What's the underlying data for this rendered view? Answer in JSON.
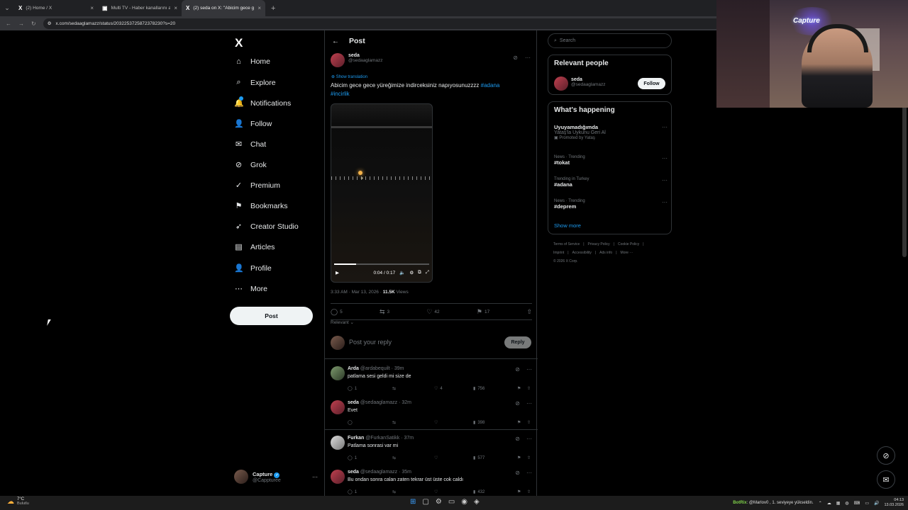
{
  "browser": {
    "tabs": [
      {
        "favicon": "X",
        "title": "(2) Home / X",
        "close": "×"
      },
      {
        "favicon": "▣",
        "title": "Multi TV - Haber kanallarını aynı",
        "close": "×"
      },
      {
        "favicon": "X",
        "title": "(2) seda on X: \"Abicim gece ge",
        "close": "×"
      }
    ],
    "new_tab": "+",
    "url": "x.com/sedaaglamazz/status/2032253725872378230?s=20"
  },
  "nav": {
    "logo": "X",
    "items": [
      {
        "icon": "home-icon",
        "glyph": "⌂",
        "label": "Home"
      },
      {
        "icon": "search-icon",
        "glyph": "⌕",
        "label": "Explore"
      },
      {
        "icon": "bell-icon",
        "glyph": "🔔",
        "label": "Notifications"
      },
      {
        "icon": "follow-icon",
        "glyph": "👤",
        "label": "Follow"
      },
      {
        "icon": "mail-icon",
        "glyph": "✉",
        "label": "Chat"
      },
      {
        "icon": "grok-icon",
        "glyph": "⊘",
        "label": "Grok"
      },
      {
        "icon": "premium-icon",
        "glyph": "✓",
        "label": "Premium"
      },
      {
        "icon": "bookmark-icon",
        "glyph": "⚑",
        "label": "Bookmarks"
      },
      {
        "icon": "rocket-icon",
        "glyph": "➶",
        "label": "Creator Studio"
      },
      {
        "icon": "articles-icon",
        "glyph": "▤",
        "label": "Articles"
      },
      {
        "icon": "profile-icon",
        "glyph": "👤",
        "label": "Profile"
      },
      {
        "icon": "more-icon",
        "glyph": "⋯",
        "label": "More"
      }
    ],
    "post_button": "Post",
    "account": {
      "name": "Capture",
      "handle": "@Cappturee",
      "menu": "···"
    }
  },
  "post": {
    "header": "Post",
    "author": {
      "name": "seda",
      "handle": "@sedaaglamazz"
    },
    "translate": "Show translation",
    "text": "Abicim gece gece yüreğimize indirceksiniz napıyosunuzzzz ",
    "tag1": "#adana",
    "tag2": "#incirlik",
    "video": {
      "time": "0:04 / 0:17",
      "progress": 0.23
    },
    "timestamp": "3:33 AM · Mar 13, 2026 · ",
    "views_count": "11.5K",
    "views_label": " Views",
    "stats": {
      "replies": "5",
      "reposts": "3",
      "likes": "42",
      "bookmarks": "17"
    },
    "sort": "Relevant ⌄",
    "reply_placeholder": "Post your reply",
    "reply_button": "Reply"
  },
  "replies": [
    {
      "name": "Arda",
      "handle": "@ardabequilt · 39m",
      "text": "patlama sesi geldi mi size de",
      "replies": "1",
      "reposts": "",
      "likes": "4",
      "views": "756"
    },
    {
      "name": "seda",
      "handle": "@sedaaglamazz · 32m",
      "text": "Evet",
      "replies": "",
      "reposts": "",
      "likes": "",
      "views": "398"
    },
    {
      "name": "Furkan",
      "handle": "@FurkanSatikk · 37m",
      "text": "Patlama sonrasi var mi",
      "replies": "1",
      "reposts": "",
      "likes": "",
      "views": "577"
    },
    {
      "name": "seda",
      "handle": "@sedaaglamazz · 35m",
      "text": "Bu ondan sonra calan zaten tekrar üst üste cok caldı",
      "replies": "1",
      "reposts": "",
      "likes": "",
      "views": "432"
    }
  ],
  "sidebar": {
    "search_placeholder": "Search",
    "relevant_title": "Relevant people",
    "person": {
      "name": "seda",
      "handle": "@sedaaglamazz",
      "button": "Follow"
    },
    "happening_title": "What's happening",
    "trends": [
      {
        "context": "",
        "title": "Uyuyamadığımda",
        "sub": "Yataş'la Uykunu Geri Al",
        "promo": "Promoted by Yataş"
      },
      {
        "context": "News · Trending",
        "title": "#tokat",
        "sub": "",
        "promo": ""
      },
      {
        "context": "Trending in Turkey",
        "title": "#adana",
        "sub": "",
        "promo": ""
      },
      {
        "context": "News · Trending",
        "title": "#deprem",
        "sub": "",
        "promo": ""
      }
    ],
    "show_more": "Show more",
    "footer": [
      "Terms of Service",
      "|",
      "Privacy Policy",
      "|",
      "Cookie Policy",
      "|",
      "Imprint",
      "|",
      "Accessibility",
      "|",
      "Ads info",
      "|",
      "More ···",
      "© 2026 X Corp."
    ]
  },
  "webcam": {
    "logo": "Capture"
  },
  "taskbar": {
    "weather_temp": "7°C",
    "weather_desc": "Bulutlu",
    "notif": "BotRix",
    "notif_text": ": @Marlov0 , 1. seviyeye yükseldin.",
    "time": "04:13",
    "date": "13.03.2026"
  }
}
